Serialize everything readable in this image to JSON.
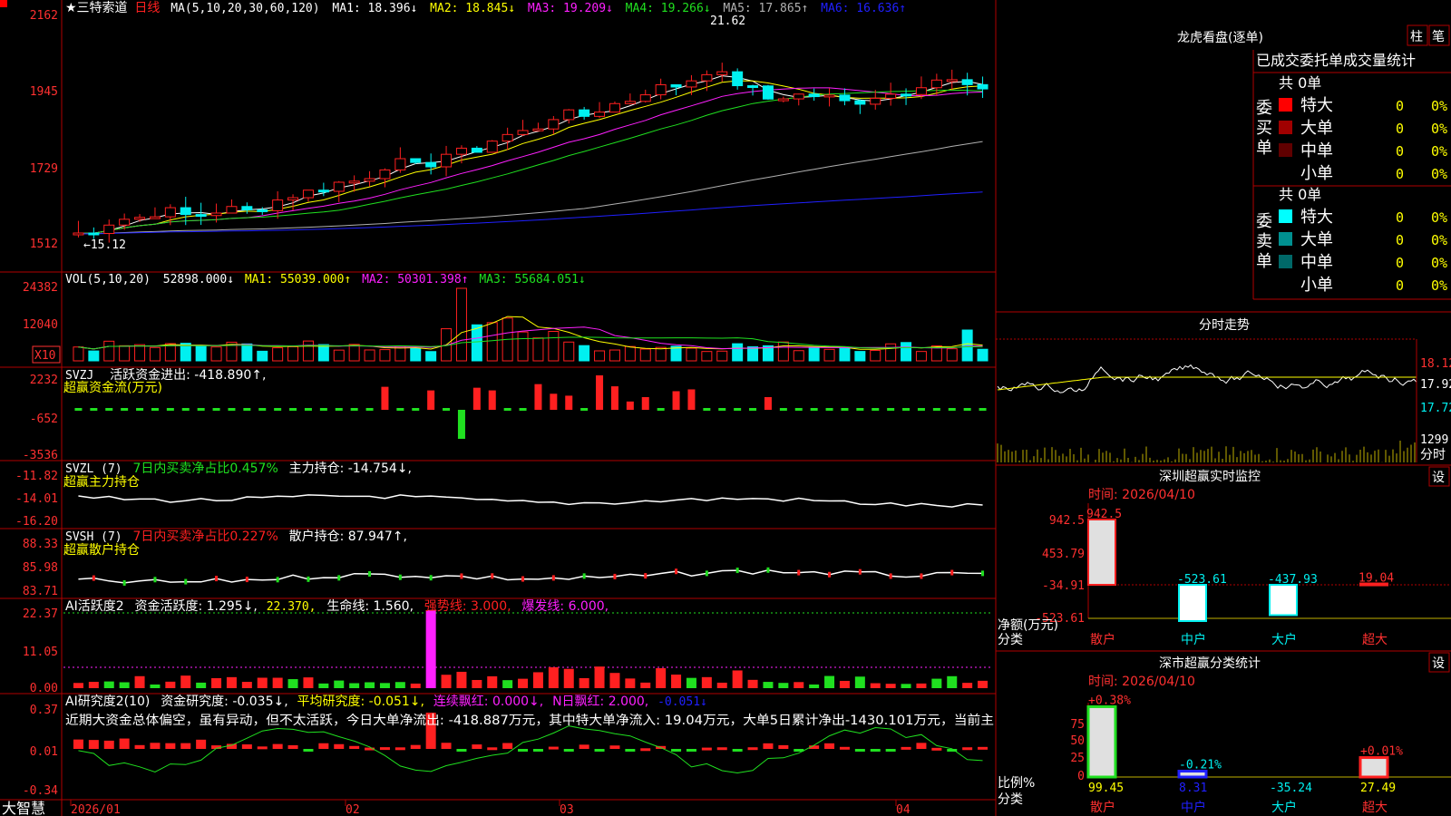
{
  "colors": {
    "bg": "#000000",
    "grid": "#b00000",
    "up": "#ff2020",
    "down": "#00f0f0",
    "yellow": "#ffff00",
    "white": "#ffffff",
    "magenta": "#ff20ff",
    "green": "#20e020",
    "blue": "#2020ff",
    "gray": "#b0b0b0"
  },
  "main": {
    "title": "★三特索道",
    "period": "日线",
    "ma_label": "MA(5,10,20,30,60,120)",
    "ma_values": [
      {
        "text": "MA1: 18.396↓",
        "color": "#ffffff"
      },
      {
        "text": "MA2: 18.845↓",
        "color": "#ffff00"
      },
      {
        "text": "MA3: 19.209↓",
        "color": "#ff20ff"
      },
      {
        "text": "MA4: 19.266↓",
        "color": "#20e020"
      },
      {
        "text": "MA5: 17.865↑",
        "color": "#b0b0b0"
      },
      {
        "text": "MA6: 16.636↑",
        "color": "#2020ff"
      }
    ],
    "y_ticks": [
      "2162",
      "1945",
      "1729",
      "1512"
    ],
    "high_label": "21.62",
    "low_label": "←15.12"
  },
  "vol": {
    "label": "VOL(5,10,20)",
    "values": [
      {
        "text": "52898.000↓",
        "color": "#ffffff"
      },
      {
        "text": "MA1: 55039.000↑",
        "color": "#ffff00"
      },
      {
        "text": "MA2: 50301.398↑",
        "color": "#ff20ff"
      },
      {
        "text": "MA3: 55684.051↓",
        "color": "#20e020"
      }
    ],
    "y_ticks": [
      "24382",
      "12040"
    ],
    "unit": "X10"
  },
  "svzj": {
    "label": "SVZJ",
    "line1": "活跃资金进出: -418.890↑,",
    "line2": "超赢资金流(万元)",
    "y_ticks": [
      "2232",
      "-652",
      "-3536"
    ]
  },
  "svzl": {
    "label": "SVZL (7)",
    "ratio": "7日内买卖净占比0.457%",
    "holding": "主力持仓: -14.754↓,",
    "line2": "超赢主力持仓",
    "y_ticks": [
      "-11.82",
      "-14.01",
      "-16.20"
    ]
  },
  "svsh": {
    "label": "SVSH (7)",
    "ratio": "7日内买卖净占比0.227%",
    "holding": "散户持仓: 87.947↑,",
    "line2": "超赢散户持仓",
    "y_ticks": [
      "88.33",
      "85.98",
      "83.71"
    ]
  },
  "ai1": {
    "label": "AI活跃度2",
    "activity": "资金活跃度: 1.295↓,",
    "v2": "22.370,",
    "life": "生命线: 1.560,",
    "strong": "强势线: 3.000,",
    "burst": "爆发线: 6.000,",
    "y_ticks": [
      "22.37",
      "11.05",
      "0.00"
    ]
  },
  "ai2": {
    "label": "AI研究度2(10)",
    "research": "资金研究度: -0.035↓,",
    "avg": "平均研究度: -0.051↓,",
    "cont": "连续飘红: 0.000↓,",
    "nday": "N日飘红: 2.000,",
    "neg": "-0.051↓",
    "comment": "近期大资金总体偏空，虽有异动，但不太活跃，今日大单净流出: -418.887万元，其中特大单净流入: 19.04万元，大单5日累计净出-1430.101万元，当前主",
    "y_ticks": [
      "0.37",
      "0.01",
      "-0.34"
    ]
  },
  "xaxis": {
    "brand": "大智慧",
    "labels": [
      "2026/01",
      "02",
      "03",
      "04"
    ]
  },
  "right": {
    "lhb_title": "龙虎看盘(逐单)",
    "btn1": "柱",
    "btn2": "笔",
    "stats_title": "已成交委托单成交量统计",
    "buy": {
      "side": "委买单",
      "total": "共 0单",
      "rows": [
        {
          "name": "特大",
          "count": "0",
          "pct": "0%",
          "color": "#ff0000"
        },
        {
          "name": "大单",
          "count": "0",
          "pct": "0%",
          "color": "#a00000"
        },
        {
          "name": "中单",
          "count": "0",
          "pct": "0%",
          "color": "#600000"
        },
        {
          "name": "小单",
          "count": "0",
          "pct": "0%",
          "color": "#000000"
        }
      ]
    },
    "sell": {
      "side": "委卖单",
      "total": "共 0单",
      "rows": [
        {
          "name": "特大",
          "count": "0",
          "pct": "0%",
          "color": "#00ffff"
        },
        {
          "name": "大单",
          "count": "0",
          "pct": "0%",
          "color": "#009090"
        },
        {
          "name": "中单",
          "count": "0",
          "pct": "0%",
          "color": "#006868"
        },
        {
          "name": "小单",
          "count": "0",
          "pct": "0%",
          "color": "#000000"
        }
      ]
    },
    "fenshi": {
      "title": "分时走势",
      "price_ticks": [
        "18.12",
        "17.92",
        "17.72"
      ],
      "vol_tick": "1299",
      "vol_unit": "分时"
    },
    "monitor": {
      "title": "深圳超赢实时监控",
      "settings": "设",
      "time": "时间: 2026/04/10",
      "y_ticks": [
        "942.5",
        "453.79",
        "-34.91",
        "-523.61"
      ],
      "axis_label": "净额(万元)",
      "class_label": "分类",
      "bars": [
        {
          "cat": "散户",
          "value": 942.5,
          "label": "942.5"
        },
        {
          "cat": "中户",
          "value": -523.61,
          "label": "-523.61"
        },
        {
          "cat": "大户",
          "value": -437.93,
          "label": "-437.93"
        },
        {
          "cat": "超大",
          "value": 19.04,
          "label": "19.04"
        }
      ]
    },
    "classstat": {
      "title": "深市超赢分类统计",
      "settings": "设",
      "time": "时间: 2026/04/10",
      "y_ticks": [
        "75",
        "50",
        "25",
        "0"
      ],
      "axis_label": "比例%",
      "class_label": "分类",
      "bars": [
        {
          "cat": "散户",
          "pct": "+0.38%",
          "value": "99.45",
          "level": 99.45
        },
        {
          "cat": "中户",
          "pct": "-0.21%",
          "value": "8.31",
          "level": 8.31
        },
        {
          "cat": "大户",
          "pct": "",
          "value": "-35.24",
          "level": 0
        },
        {
          "cat": "超大",
          "pct": "+0.01%",
          "value": "27.49",
          "level": 27.49
        }
      ]
    }
  }
}
